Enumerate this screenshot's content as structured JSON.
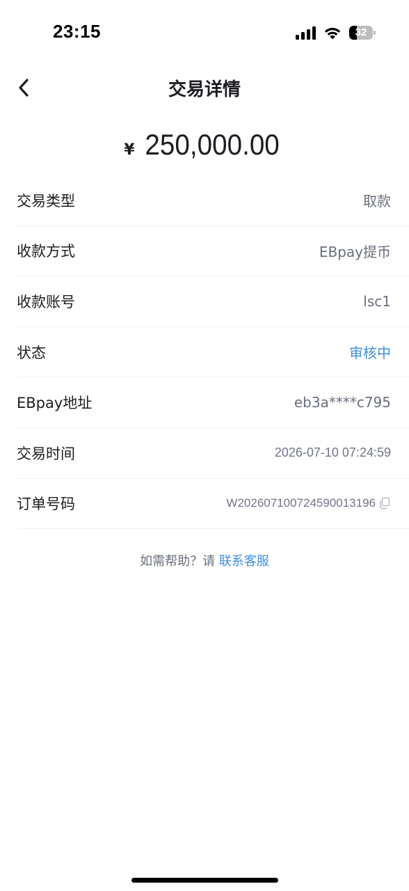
{
  "status_bar": {
    "time": "23:15",
    "battery_level": "32",
    "signal_icon": "cellular-signal-icon",
    "wifi_icon": "wifi-icon",
    "battery_icon": "battery-icon"
  },
  "header": {
    "title": "交易详情",
    "back_icon": "chevron-left-icon"
  },
  "amount": {
    "currency": "¥",
    "value": "250,000.00"
  },
  "details": [
    {
      "label": "交易类型",
      "value": "取款"
    },
    {
      "label": "收款方式",
      "value": "EBpay提币"
    },
    {
      "label": "收款账号",
      "value": "lsc1"
    },
    {
      "label": "状态",
      "value": "审核中"
    },
    {
      "label": "EBpay地址",
      "value": "eb3a****c795"
    },
    {
      "label": "交易时间",
      "value": "2026-07-10 07:24:59"
    },
    {
      "label": "订单号码",
      "value": "W20260710072459001319​6",
      "copy_icon": "copy-icon"
    }
  ],
  "help": {
    "prefix": "如需帮助？请 ",
    "link": "联系客服"
  },
  "colors": {
    "accent_blue": "#3f8fe0",
    "text_primary": "#1c1d22",
    "text_secondary": "#6b6f7e",
    "divider": "#f0f0f2"
  }
}
